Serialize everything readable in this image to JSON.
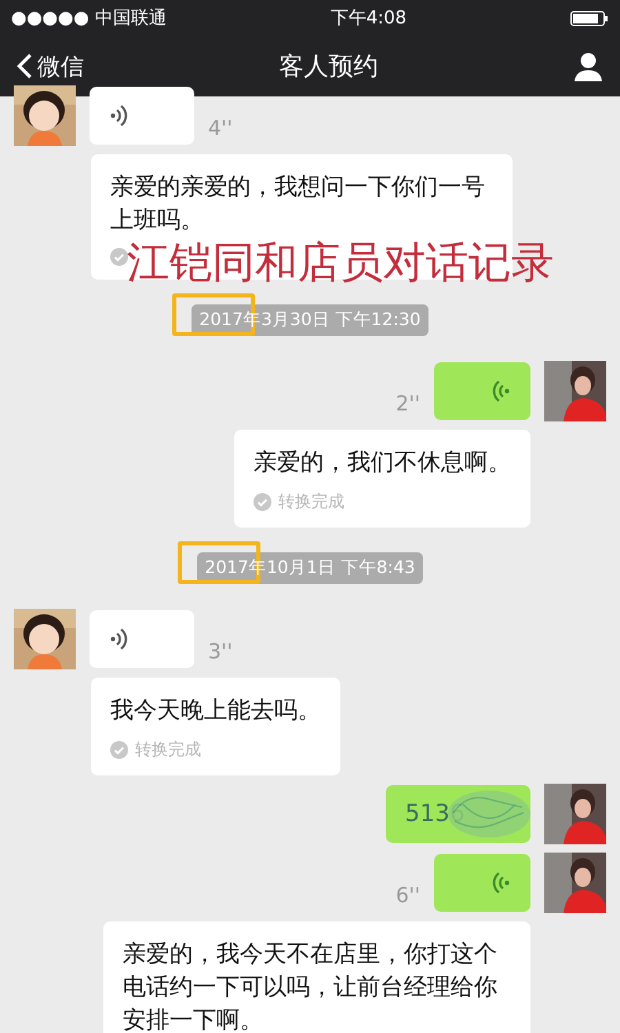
{
  "status_bar": {
    "carrier": "●●●●● 中国联通",
    "time": "下午4:08"
  },
  "nav": {
    "back": "微信",
    "title": "客人预约"
  },
  "overlay_caption": "江铠同和店员对话记录",
  "messages": [
    {
      "kind": "voice",
      "outgoing": false,
      "duration": "4''",
      "transcript": {
        "text": "亲爱的亲爱的，我想问一下你们一号上班吗。",
        "status_obscured": true
      }
    },
    {
      "kind": "time",
      "text": "2017年3月30日 下午12:30",
      "highlighted": true
    },
    {
      "kind": "voice",
      "outgoing": true,
      "duration": "2''",
      "transcript": {
        "text": "亲爱的，我们不休息啊。",
        "status": "转换完成"
      }
    },
    {
      "kind": "time",
      "text": "2017年10月1日 下午8:43",
      "highlighted": true
    },
    {
      "kind": "voice",
      "outgoing": false,
      "duration": "3''",
      "transcript": {
        "text": "我今天晚上能去吗。",
        "status": "转换完成"
      }
    },
    {
      "kind": "phone",
      "outgoing": true,
      "text": "5136"
    },
    {
      "kind": "voice",
      "outgoing": true,
      "duration": "6''",
      "transcript": {
        "text": "亲爱的，我今天不在店里，你打这个电话约一下可以吗，让前台经理给你安排一下啊。"
      }
    }
  ]
}
